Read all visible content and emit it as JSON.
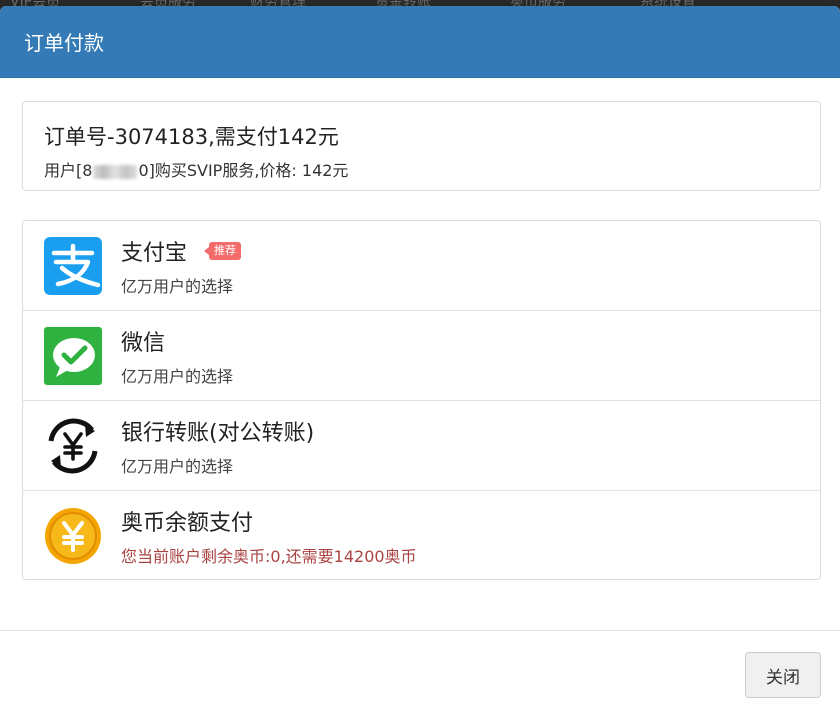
{
  "backdrop": {
    "nav_items": [
      "VIP会员",
      "会员服务",
      "财务管理",
      "资金转账",
      "奥币服务",
      "系统设置"
    ]
  },
  "modal": {
    "title": "订单付款"
  },
  "order": {
    "title": "订单号-3074183,需支付142元",
    "desc_prefix": "用户[8",
    "desc_suffix": "0]购买SVIP服务,价格: 142元"
  },
  "payment_methods": [
    {
      "name": "支付宝",
      "subtitle": "亿万用户的选择",
      "badge": "推荐",
      "icon": "alipay-icon",
      "color": "#1a9ff0"
    },
    {
      "name": "微信",
      "subtitle": "亿万用户的选择",
      "icon": "wechat-icon",
      "color": "#2fb240"
    },
    {
      "name": "银行转账(对公转账)",
      "subtitle": "亿万用户的选择",
      "icon": "bank-transfer-icon",
      "color": "#111111"
    },
    {
      "name": "奥币余额支付",
      "subtitle": "您当前账户剩余奥币:0,还需要14200奥币",
      "icon": "coin-icon",
      "color": "#f5a500"
    }
  ],
  "footer": {
    "close_label": "关闭"
  },
  "colors": {
    "header": "#337ab7",
    "warning_text": "#a94442",
    "badge": "#f46b6b"
  }
}
